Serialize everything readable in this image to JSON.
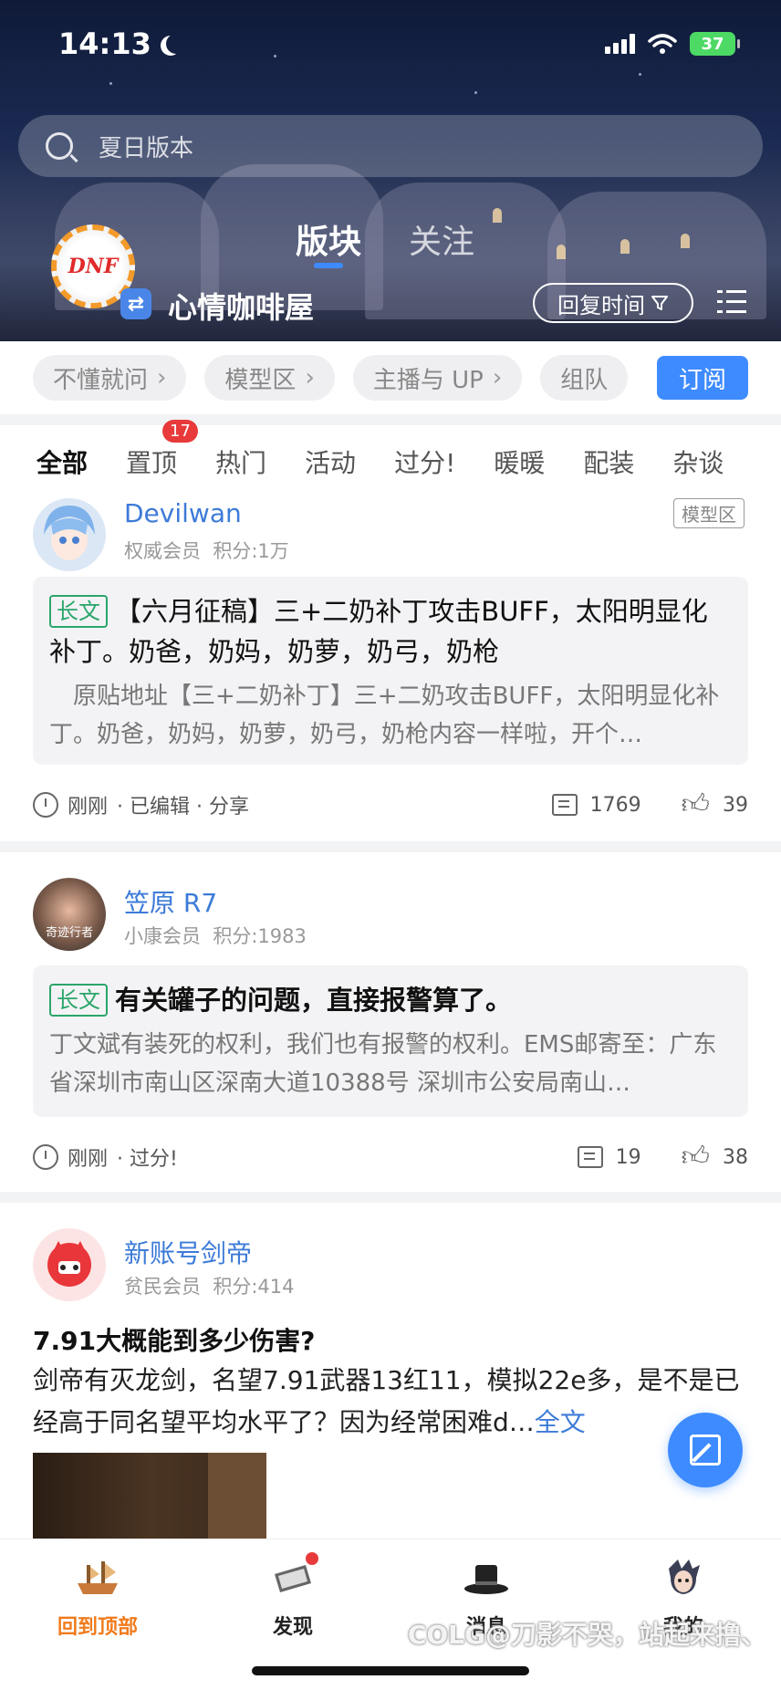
{
  "status": {
    "time": "14:13",
    "battery": "37"
  },
  "search": {
    "placeholder": "夏日版本"
  },
  "board": {
    "logo_text": "DNF",
    "tabs": [
      {
        "label": "版块"
      },
      {
        "label": "关注"
      }
    ],
    "name": "心情咖啡屋",
    "sort_label": "回复时间"
  },
  "chips": [
    {
      "label": "不懂就问"
    },
    {
      "label": "模型区"
    },
    {
      "label": "主播与 UP"
    },
    {
      "label": "组队"
    }
  ],
  "subscribe_label": "订阅",
  "categories": [
    {
      "label": "全部"
    },
    {
      "label": "置顶",
      "badge": "17"
    },
    {
      "label": "热门"
    },
    {
      "label": "活动"
    },
    {
      "label": "过分!"
    },
    {
      "label": "暖暖"
    },
    {
      "label": "配装"
    },
    {
      "label": "杂谈"
    }
  ],
  "posts": [
    {
      "username": "Devilwan",
      "rank": "权威会员",
      "points": "积分:1万",
      "zone_tag": "模型区",
      "tag": "长文",
      "title": "【六月征稿】三+二奶补丁攻击BUFF，太阳明显化补丁。奶爸，奶妈，奶萝，奶弓，奶枪",
      "excerpt": "　原贴地址【三+二奶补丁】三+二奶攻击BUFF，太阳明显化补丁。奶爸，奶妈，奶萝，奶弓，奶枪内容一样啦，开个…",
      "time": "刚刚",
      "extra": "· 已编辑 · 分享",
      "comments": "1769",
      "likes": "39"
    },
    {
      "username": "笠原 R7",
      "rank": "小康会员",
      "points": "积分:1983",
      "avatar_caption": "奇迹行者",
      "tag": "长文",
      "title": "有关罐子的问题，直接报警算了。",
      "excerpt": "丁文斌有装死的权利，我们也有报警的权利。EMS邮寄至：广东省深圳市南山区深南大道10388号 深圳市公安局南山…",
      "time": "刚刚",
      "extra": "· 过分!",
      "comments": "19",
      "likes": "38"
    },
    {
      "username": "新账号剑帝",
      "rank": "贫民会员",
      "points": "积分:414",
      "title": "7.91大概能到多少伤害?",
      "body": "剑帝有灭龙剑，名望7.91武器13红11，模拟22e多，是不是已经高于同名望平均水平了？因为经常困难d…",
      "fulltext": "全文"
    }
  ],
  "nav": [
    {
      "label": "回到顶部",
      "icon": "ship-icon"
    },
    {
      "label": "发现",
      "icon": "discover-icon"
    },
    {
      "label": "消息",
      "icon": "hat-icon"
    },
    {
      "label": "我的",
      "icon": "profile-icon"
    }
  ],
  "watermark": "COLG@刀影不哭，站起来撸、",
  "colors": {
    "accent": "#3d8bff",
    "long_tag": "#2ba56a",
    "active_nav": "#f07b1d",
    "badge": "#e83a3a"
  }
}
